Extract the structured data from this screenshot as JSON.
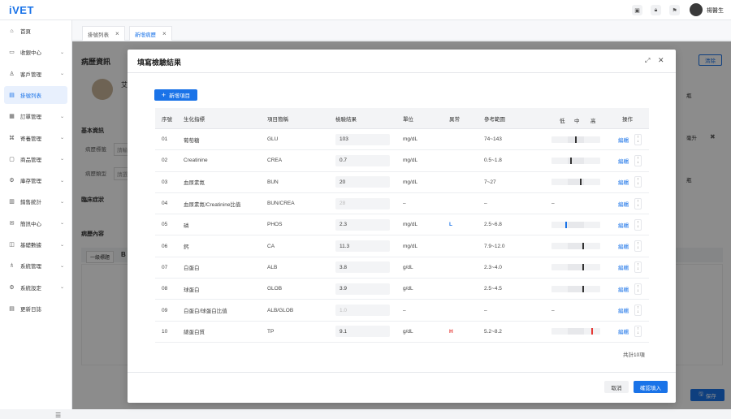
{
  "app": {
    "logo": "iVET",
    "username": "楊醫生"
  },
  "topbar": {
    "icons": [
      "image-icon",
      "lock-icon",
      "flag-icon"
    ]
  },
  "sidebar": {
    "items": [
      {
        "label": "首頁",
        "icon": "home-icon",
        "chevron": false,
        "active": false
      },
      {
        "label": "收銀中心",
        "icon": "cashier-icon",
        "chevron": true,
        "active": false
      },
      {
        "label": "客戶管理",
        "icon": "user-icon",
        "chevron": true,
        "active": false
      },
      {
        "label": "掛號列表",
        "icon": "list-icon",
        "chevron": false,
        "active": true
      },
      {
        "label": "訂單管理",
        "icon": "order-icon",
        "chevron": true,
        "active": false
      },
      {
        "label": "寄養管理",
        "icon": "boarding-icon",
        "chevron": true,
        "active": false
      },
      {
        "label": "商品管理",
        "icon": "product-icon",
        "chevron": true,
        "active": false
      },
      {
        "label": "庫存管理",
        "icon": "inventory-icon",
        "chevron": true,
        "active": false
      },
      {
        "label": "銷售統計",
        "icon": "stats-icon",
        "chevron": true,
        "active": false
      },
      {
        "label": "簡訊中心",
        "icon": "message-icon",
        "chevron": true,
        "active": false
      },
      {
        "label": "基礎數據",
        "icon": "data-icon",
        "chevron": true,
        "active": false
      },
      {
        "label": "系統管理",
        "icon": "admin-icon",
        "chevron": true,
        "active": false
      },
      {
        "label": "系統設定",
        "icon": "settings-icon",
        "chevron": true,
        "active": false
      },
      {
        "label": "更新日誌",
        "icon": "log-icon",
        "chevron": false,
        "active": false
      }
    ]
  },
  "tabs": [
    {
      "label": "掛號列表",
      "active": false
    },
    {
      "label": "新增病歷",
      "active": true
    }
  ],
  "background": {
    "title": "病歷資訊",
    "clear_label": "清除",
    "pet_initial": "艾",
    "basic_info": "基本資訊",
    "record_label": "病歷標籤",
    "record_label_ph": "請輸",
    "record_type": "病歷類型",
    "record_type_ph": "請選",
    "clinical": "臨床症狀",
    "content": "病歷內容",
    "heading_select": "一級標題",
    "bold_label": "B",
    "right_label1": "瓶",
    "right_label2": "毫升",
    "right_label3": "瓶",
    "save_label": "保存"
  },
  "modal": {
    "title": "填寫檢驗結果",
    "add_label": "新增項目",
    "headers": {
      "no": "序號",
      "name": "生化指標",
      "abbr": "項目簡稱",
      "result": "檢驗結果",
      "unit": "單位",
      "abnormal": "異常",
      "ref": "參考範圍",
      "low": "低",
      "mid": "中",
      "high": "高",
      "action": "操作"
    },
    "rows": [
      {
        "no": "01",
        "name": "葡萄糖",
        "abbr": "GLU",
        "result": "103",
        "unit": "mg/dL",
        "abnormal": "",
        "ref": "74~143",
        "level": 0.5,
        "editable": true
      },
      {
        "no": "02",
        "name": "Creatinine",
        "abbr": "CREA",
        "result": "0.7",
        "unit": "mg/dL",
        "abnormal": "",
        "ref": "0.5~1.8",
        "level": 0.4,
        "editable": true
      },
      {
        "no": "03",
        "name": "血尿素氮",
        "abbr": "BUN",
        "result": "20",
        "unit": "mg/dL",
        "abnormal": "",
        "ref": "7~27",
        "level": 0.6,
        "editable": true
      },
      {
        "no": "04",
        "name": "血尿素氮/Creatinine比值",
        "abbr": "BUN/CREA",
        "result": "28",
        "unit": "–",
        "abnormal": "",
        "ref": "–",
        "level": null,
        "editable": false
      },
      {
        "no": "05",
        "name": "磷",
        "abbr": "PHOS",
        "result": "2.3",
        "unit": "mg/dL",
        "abnormal": "L",
        "ref": "2.5~6.8",
        "level": 0.3,
        "editable": true
      },
      {
        "no": "06",
        "name": "鈣",
        "abbr": "CA",
        "result": "11.3",
        "unit": "mg/dL",
        "abnormal": "",
        "ref": "7.9~12.0",
        "level": 0.65,
        "editable": true
      },
      {
        "no": "07",
        "name": "白蛋白",
        "abbr": "ALB",
        "result": "3.8",
        "unit": "g/dL",
        "abnormal": "",
        "ref": "2.3~4.0",
        "level": 0.65,
        "editable": true
      },
      {
        "no": "08",
        "name": "球蛋白",
        "abbr": "GLOB",
        "result": "3.9",
        "unit": "g/dL",
        "abnormal": "",
        "ref": "2.5~4.5",
        "level": 0.65,
        "editable": true
      },
      {
        "no": "09",
        "name": "白蛋白/球蛋白比值",
        "abbr": "ALB/GLOB",
        "result": "1.0",
        "unit": "–",
        "abnormal": "",
        "ref": "–",
        "level": null,
        "editable": false
      },
      {
        "no": "10",
        "name": "總蛋白質",
        "abbr": "TP",
        "result": "9.1",
        "unit": "g/dL",
        "abnormal": "H",
        "ref": "5.2~8.2",
        "level": 0.83,
        "editable": true
      }
    ],
    "edit_label": "編輯",
    "dash": "–",
    "total": "共計10項",
    "cancel_label": "取消",
    "confirm_label": "確認填入"
  }
}
